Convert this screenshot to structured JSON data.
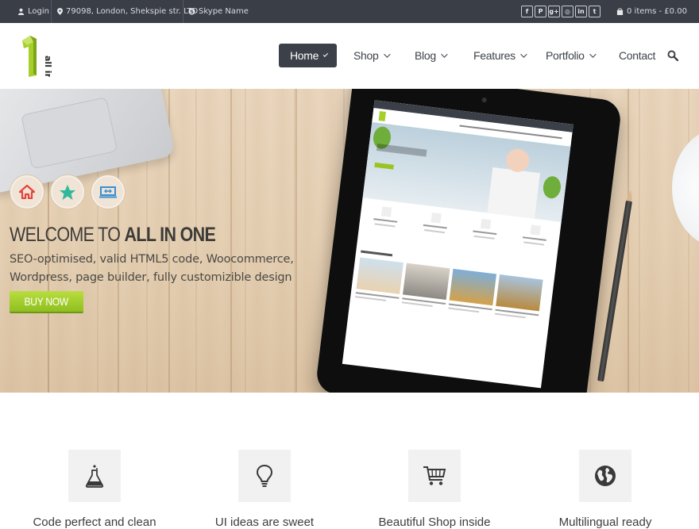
{
  "topbar": {
    "login": "Login",
    "address": "79098, London, Shekspie str. LTD",
    "skype": "Skype Name",
    "socials": [
      {
        "icon": "facebook-icon",
        "glyph": "f"
      },
      {
        "icon": "pinterest-icon",
        "glyph": "P"
      },
      {
        "icon": "google-plus-icon",
        "glyph": "g+"
      },
      {
        "icon": "dribbble-icon",
        "glyph": "◎"
      },
      {
        "icon": "linkedin-icon",
        "glyph": "in"
      },
      {
        "icon": "twitter-icon",
        "glyph": "t"
      }
    ],
    "cart": "0 items - £0.00"
  },
  "header": {
    "logo_text": "all in",
    "logo_number": "1",
    "nav": [
      {
        "label": "Home",
        "active": true,
        "dropdown": true
      },
      {
        "label": "Shop",
        "active": false,
        "dropdown": true
      },
      {
        "label": "Blog",
        "active": false,
        "dropdown": true
      },
      {
        "label": "Features",
        "active": false,
        "dropdown": true
      },
      {
        "label": "Portfolio",
        "active": false,
        "dropdown": true
      },
      {
        "label": "Contact",
        "active": false,
        "dropdown": false
      }
    ]
  },
  "hero": {
    "icons": [
      "home-icon",
      "star-icon",
      "monitor-icon"
    ],
    "welcome_prefix": "WELCOME TO ",
    "welcome_strong": "ALL IN ONE",
    "tagline": "SEO-optimised, valid HTML5 code, Woocommerce, Wordpress, page builder, fully customizible design",
    "buy_button": "BUY NOW"
  },
  "features": [
    {
      "icon": "flask-icon",
      "title": "Code perfect and clean"
    },
    {
      "icon": "lightbulb-icon",
      "title": "UI ideas are sweet"
    },
    {
      "icon": "cart-icon",
      "title": "Beautiful Shop inside"
    },
    {
      "icon": "globe-icon",
      "title": "Multilingual ready"
    }
  ],
  "colors": {
    "topbar_bg": "#3a3e47",
    "nav_active_bg": "#3b4049",
    "accent_green": "#9ac424",
    "text_dark": "#3d3b38"
  }
}
